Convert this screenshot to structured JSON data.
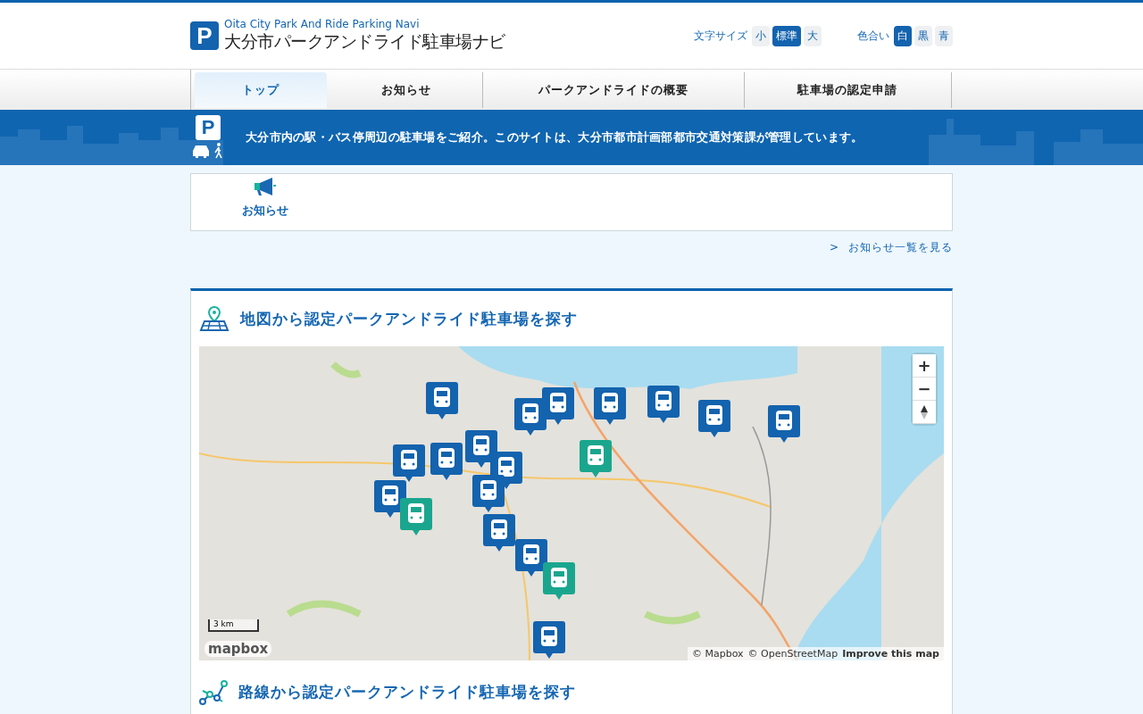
{
  "header": {
    "logo_letter": "P",
    "subtitle": "Oita City Park And Ride Parking Navi",
    "title": "大分市パークアンドライド駐車場ナビ"
  },
  "text_size": {
    "label": "文字サイズ",
    "options": [
      {
        "label": "小",
        "selected": false
      },
      {
        "label": "標準",
        "selected": true
      },
      {
        "label": "大",
        "selected": false
      }
    ]
  },
  "color_scheme": {
    "label": "色合い",
    "options": [
      {
        "label": "白",
        "selected": true
      },
      {
        "label": "黒",
        "selected": false
      },
      {
        "label": "青",
        "selected": false
      }
    ]
  },
  "nav": [
    {
      "label": "トップ",
      "selected": true
    },
    {
      "label": "お知らせ",
      "selected": false
    },
    {
      "label": "パークアンドライドの概要",
      "selected": false
    },
    {
      "label": "駐車場の認定申請",
      "selected": false
    }
  ],
  "banner": {
    "icon_letter": "P",
    "message": "大分市内の駅・バス停周辺の駐車場をご紹介。このサイトは、大分市都市計画部都市交通対策課が管理しています。"
  },
  "notices": {
    "title": "お知らせ",
    "more_arrow": ">",
    "more_link": "お知らせ一覧を見る"
  },
  "sections": [
    {
      "kind": "map",
      "title": "地図から認定パークアンドライド駐車場を探す",
      "map": {
        "zoom_in": "+",
        "zoom_out": "−",
        "scale": "3 km",
        "logo": "mapbox",
        "attribution": [
          "© Mapbox",
          "© OpenStreetMap",
          "Improve this map"
        ]
      }
    },
    {
      "kind": "route",
      "title": "路線から認定パークアンドライド駐車場を探す"
    }
  ]
}
